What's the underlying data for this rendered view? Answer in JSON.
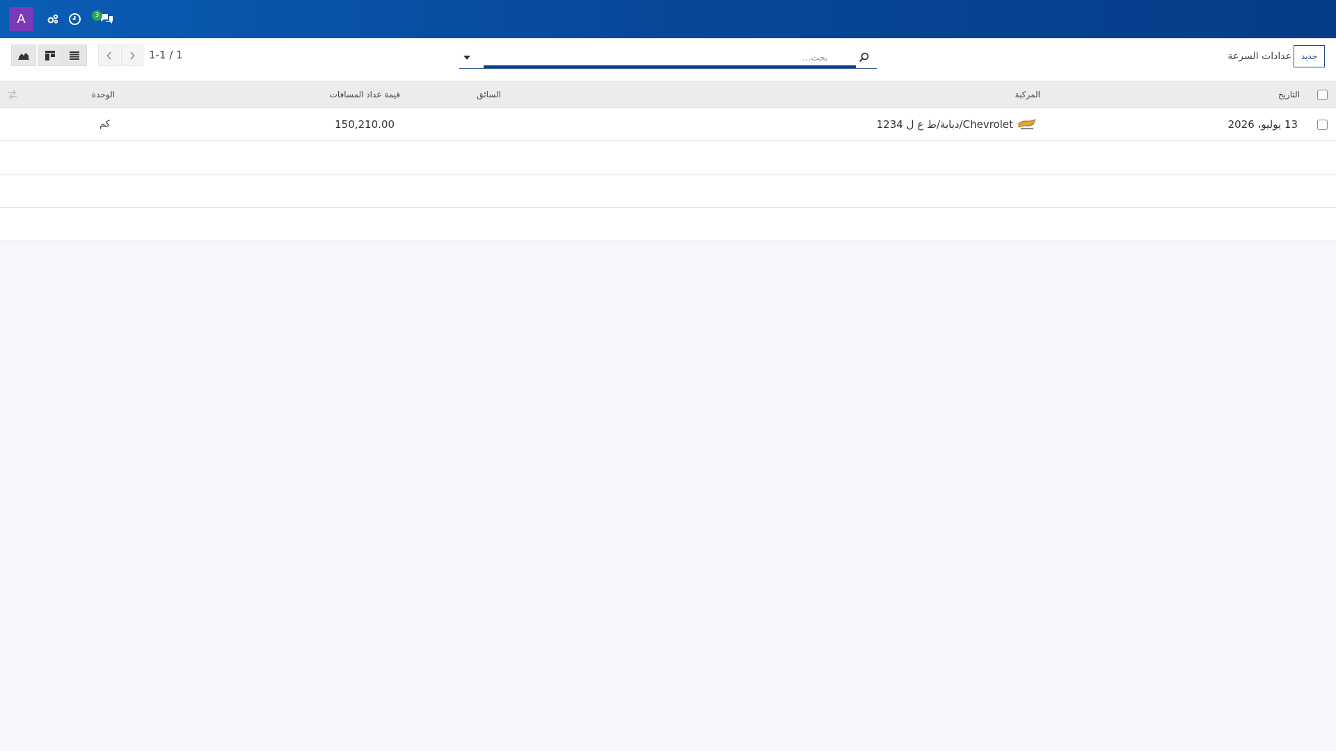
{
  "navbar": {
    "user_initial": "A",
    "icons": [
      "activity-cogs-icon",
      "clock-icon",
      "chat-icon"
    ],
    "chat_badge_count": "3"
  },
  "control_panel": {
    "pager_value": "1-1 / 1",
    "search_placeholder": "بحث...",
    "breadcrumb": "عدادات السرعة",
    "new_button_label": "جديد",
    "view_icons": [
      "graph-icon",
      "kanban-icon",
      "list-icon"
    ]
  },
  "table": {
    "headers": {
      "date": "التاريخ",
      "vehicle": "المركبة",
      "driver": "السائق",
      "odometer_value": "قيمة عداد المسافات",
      "unit": "الوحدة"
    },
    "rows": [
      {
        "date": "13 يوليو، 2026",
        "vehicle_brand": "Chevrolet",
        "vehicle_model": "/دبابة/ط ع ل 1234",
        "driver": "",
        "odometer_value": "150,210.00",
        "unit": "كم"
      }
    ],
    "empty_rows": 3
  },
  "colors": {
    "navbar": "#0a5db5",
    "accent": "#06408c",
    "avatar": "#7b3ab9",
    "badge": "#2ea44f"
  }
}
